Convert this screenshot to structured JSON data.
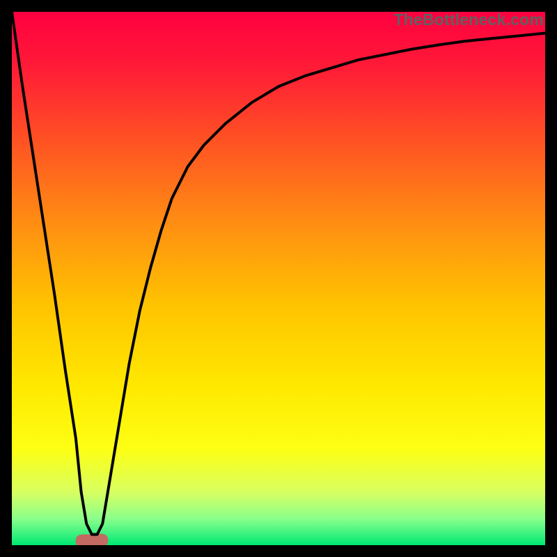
{
  "watermark": "TheBottleneck.com",
  "chart_data": {
    "type": "line",
    "title": "",
    "xlabel": "",
    "ylabel": "",
    "xlim": [
      0,
      100
    ],
    "ylim": [
      0,
      100
    ],
    "x": [
      0,
      2,
      4,
      6,
      8,
      10,
      12,
      13,
      14,
      15,
      16,
      17,
      18,
      20,
      22,
      24,
      26,
      28,
      30,
      33,
      36,
      40,
      45,
      50,
      55,
      60,
      65,
      70,
      75,
      80,
      85,
      90,
      95,
      100
    ],
    "y": [
      100,
      86,
      73,
      60,
      47,
      33,
      20,
      10,
      4,
      2,
      2,
      4,
      10,
      22,
      34,
      44,
      52,
      59,
      65,
      71,
      75,
      79,
      83,
      86,
      88,
      89.5,
      91,
      92,
      93,
      93.8,
      94.5,
      95,
      95.5,
      96
    ],
    "series_count": 1,
    "gradient_stops": [
      {
        "offset": 0.0,
        "color": "#ff0040"
      },
      {
        "offset": 0.1,
        "color": "#ff1a37"
      },
      {
        "offset": 0.25,
        "color": "#ff5522"
      },
      {
        "offset": 0.4,
        "color": "#ff8f12"
      },
      {
        "offset": 0.55,
        "color": "#ffc300"
      },
      {
        "offset": 0.7,
        "color": "#ffe800"
      },
      {
        "offset": 0.82,
        "color": "#fdff14"
      },
      {
        "offset": 0.9,
        "color": "#d8ff60"
      },
      {
        "offset": 0.95,
        "color": "#8bff8b"
      },
      {
        "offset": 1.0,
        "color": "#00e874"
      }
    ],
    "marker": {
      "x_center": 15.0,
      "width": 3.5,
      "y": 2.0,
      "color": "#c36a62"
    },
    "curve_color": "#000000",
    "curve_width": 4
  }
}
